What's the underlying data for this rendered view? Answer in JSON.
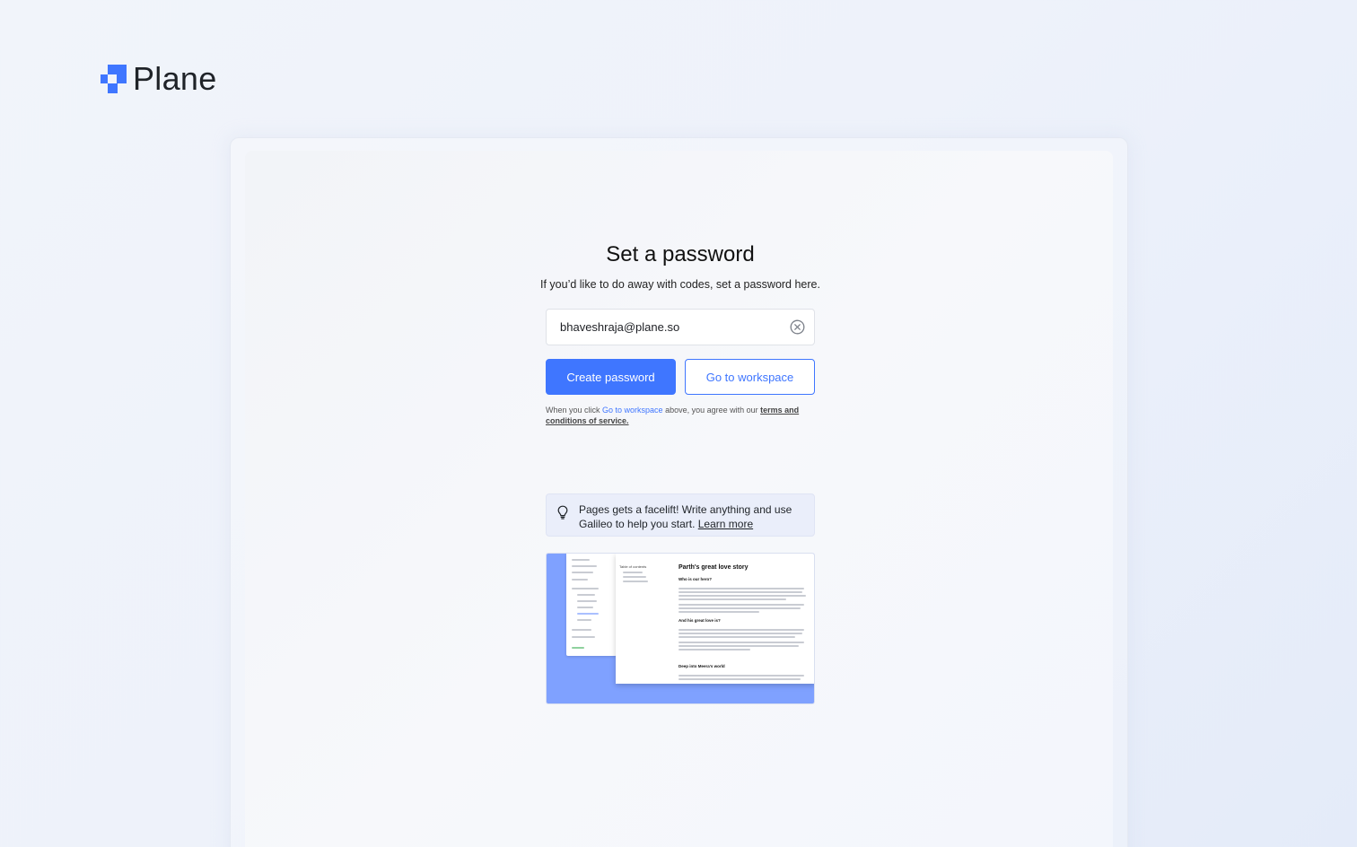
{
  "brand": {
    "name": "Plane",
    "accent": "#3f76ff"
  },
  "form": {
    "title": "Set a password",
    "subtitle": "If you’d like to do away with codes, set a password here.",
    "email_value": "bhaveshraja@plane.so",
    "create_password_label": "Create password",
    "go_to_workspace_label": "Go to workspace",
    "terms": {
      "prefix": "When you click ",
      "link": "Go to workspace",
      "middle": " above, you agree with our ",
      "terms_link": "terms and conditions of service."
    }
  },
  "tip": {
    "text": "Pages gets a facelift! Write anything and use Galileo to help you start. ",
    "link": "Learn more"
  },
  "preview": {
    "toc_title": "Table of contents",
    "doc_title": "Parth's great love story",
    "h_who": "Who is our hero?",
    "h_love": "And his great love is?",
    "h_world": "Deep into Meera's world"
  }
}
